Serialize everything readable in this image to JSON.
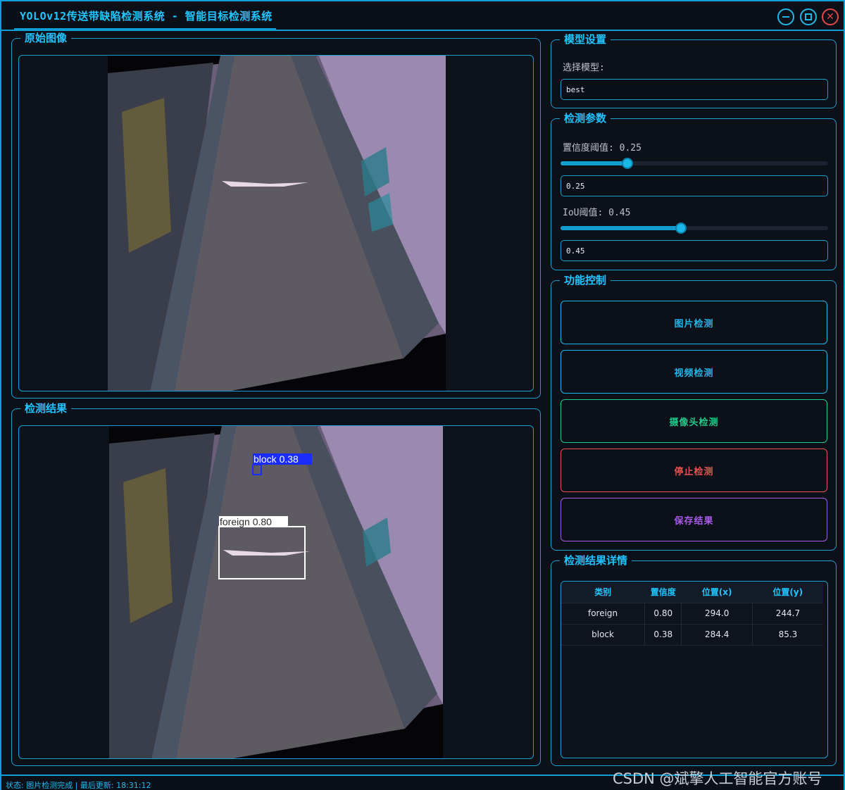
{
  "window": {
    "title": "YOLOv12传送带缺陷检测系统 - 智能目标检测系统",
    "minimize_icon": "minimize-icon",
    "maximize_icon": "maximize-icon",
    "close_icon": "close-icon",
    "close_glyph": "✕"
  },
  "original_panel": {
    "title": "原始图像"
  },
  "result_panel": {
    "title": "检测结果",
    "detections": [
      {
        "label": "block 0.38",
        "color": "#1a2cff"
      },
      {
        "label": "foreign 0.80",
        "color": "#ffffff"
      }
    ]
  },
  "model_settings": {
    "title": "模型设置",
    "select_label": "选择模型:",
    "model_value": "best"
  },
  "detect_params": {
    "title": "检测参数",
    "conf_label": "置信度阈值: 0.25",
    "conf_value": "0.25",
    "conf": 0.25,
    "iou_label": "IoU阈值: 0.45",
    "iou_value": "0.45",
    "iou": 0.45
  },
  "controls": {
    "title": "功能控制",
    "buttons": [
      {
        "label": "图片检测",
        "color": "#1fb6e8"
      },
      {
        "label": "视频检测",
        "color": "#1fb6e8"
      },
      {
        "label": "摄像头检测",
        "color": "#21c98a"
      },
      {
        "label": "停止检测",
        "color": "#e85050"
      },
      {
        "label": "保存结果",
        "color": "#a85ae8"
      }
    ]
  },
  "details": {
    "title": "检测结果详情",
    "headers": [
      "类别",
      "置信度",
      "位置(x)",
      "位置(y)"
    ],
    "rows": [
      [
        "foreign",
        "0.80",
        "294.0",
        "244.7"
      ],
      [
        "block",
        "0.38",
        "284.4",
        "85.3"
      ]
    ]
  },
  "status": {
    "text": "状态: 图片检测完成 | 最后更新: 18:31:12"
  },
  "watermark": "CSDN @斌擎人工智能官方账号"
}
